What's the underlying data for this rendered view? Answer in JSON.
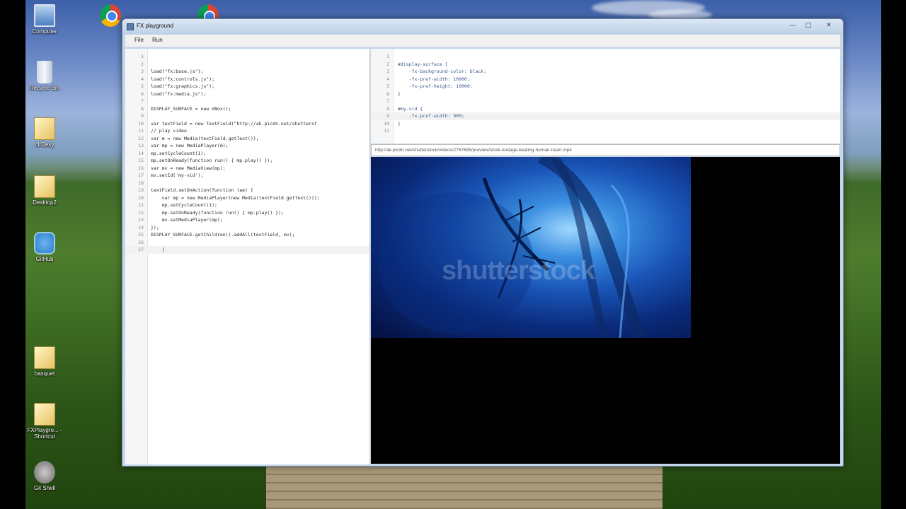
{
  "desktop": {
    "icons": [
      {
        "label": "Computer"
      },
      {
        "label": "Recycle Bin"
      },
      {
        "label": "clrDesy"
      },
      {
        "label": "Desktop2"
      },
      {
        "label": "GitHub"
      },
      {
        "label": "basquet"
      },
      {
        "label": "FXPlaygro... - Shortcut"
      },
      {
        "label": "Git Shell"
      }
    ]
  },
  "window": {
    "title": "FX playground",
    "controls": {
      "minimize": "—",
      "maximize": "□",
      "close": "✕"
    },
    "menu": {
      "file": "File",
      "run": "Run"
    }
  },
  "js_editor": {
    "lines": [
      {
        "n": "1",
        "text": ""
      },
      {
        "n": "2",
        "text": ""
      },
      {
        "n": "3",
        "text": "load(\"fx:base.js\");"
      },
      {
        "n": "4",
        "text": "load(\"fx:controls.js\");"
      },
      {
        "n": "5",
        "text": "load(\"fx:graphics.js\");"
      },
      {
        "n": "6",
        "text": "load(\"fx:media.js\");"
      },
      {
        "n": "7",
        "text": ""
      },
      {
        "n": "8",
        "text": "DISPLAY_SURFACE = new VBox();"
      },
      {
        "n": "9",
        "text": ""
      },
      {
        "n": "10",
        "text": "var textField = new TextField(\"http://ak.picdn.net/shutterst"
      },
      {
        "n": "11",
        "text": "// play video"
      },
      {
        "n": "12",
        "text": "var m = new Media(textField.getText());"
      },
      {
        "n": "13",
        "text": "var mp = new MediaPlayer(m);"
      },
      {
        "n": "14",
        "text": "mp.setCycleCount(1);"
      },
      {
        "n": "15",
        "text": "mp.setOnReady(function run() { mp.play() });"
      },
      {
        "n": "16",
        "text": "var mv = new MediaView(mp);"
      },
      {
        "n": "17",
        "text": "mv.setId('my-vid');"
      },
      {
        "n": "18",
        "text": ""
      },
      {
        "n": "19",
        "text": "textField.setOnAction(function (ae) {"
      },
      {
        "n": "20",
        "text": "    var mp = new MediaPlayer(new Media(textField.getText()));"
      },
      {
        "n": "21",
        "text": "    mp.setCycleCount(1);"
      },
      {
        "n": "22",
        "text": "    mp.setOnReady(function run() { mp.play() });"
      },
      {
        "n": "23",
        "text": "    mv.setMediaPlayer(mp);"
      },
      {
        "n": "24",
        "text": "});"
      },
      {
        "n": "25",
        "text": "DISPLAY_SURFACE.getChildren().addAll(textField, mv);"
      },
      {
        "n": "26",
        "text": ""
      },
      {
        "n": "27",
        "text": "    |"
      }
    ]
  },
  "css_editor": {
    "lines": [
      {
        "n": "1",
        "text": ""
      },
      {
        "n": "2",
        "text": "#display-surface {"
      },
      {
        "n": "3",
        "text": "    -fx-background-color: black;"
      },
      {
        "n": "4",
        "text": "    -fx-pref-width: 10000;"
      },
      {
        "n": "5",
        "text": "    -fx-pref-height: 10000;"
      },
      {
        "n": "6",
        "text": "}"
      },
      {
        "n": "7",
        "text": ""
      },
      {
        "n": "8",
        "text": "#my-vid {"
      },
      {
        "n": "9",
        "text": "    -fx-pref-width: 900;"
      },
      {
        "n": "10",
        "text": "}"
      },
      {
        "n": "11",
        "text": ""
      }
    ]
  },
  "display_surface": {
    "url": "http://ak.picdn.net/shutterstock/videos/2757695/preview/stock-footage-beating-human-heart.mp4",
    "video_watermark": "shutterstock"
  }
}
